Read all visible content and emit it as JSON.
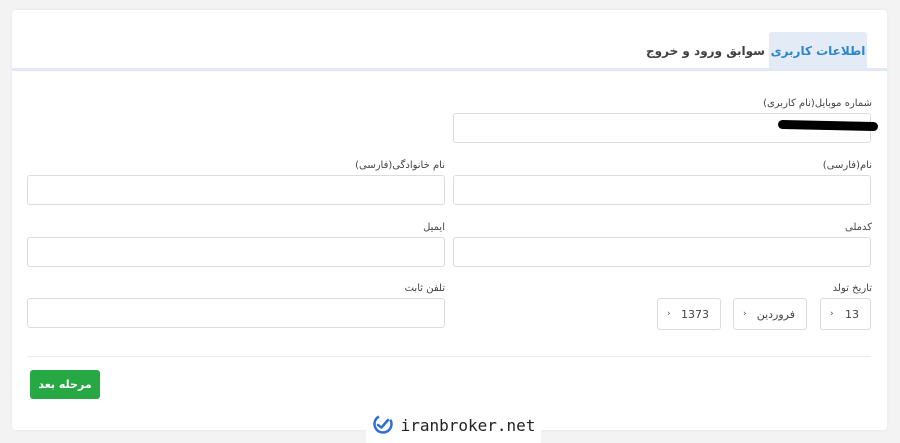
{
  "tabs": [
    {
      "label": "اطلاعات کاربری",
      "active": true
    },
    {
      "label": "سوابق ورود و خروج",
      "active": false
    }
  ],
  "form": {
    "mobile_label": "شماره موبایل(نام کاربری)",
    "mobile_value": "",
    "first_name_label": "نام(فارسی)",
    "last_name_label": "نام خانوادگی(فارسی)",
    "national_code_label": "کدملی",
    "email_label": "ایمیل",
    "birth_date_label": "تاریخ تولد",
    "birth_day": "13",
    "birth_month": "فروردین",
    "birth_year": "1373",
    "landline_label": "تلفن ثابت"
  },
  "actions": {
    "next_label": "مرحله بعد"
  },
  "watermark": {
    "text": "iranbroker.net"
  },
  "colors": {
    "accent": "#2d87c8",
    "button": "#28a745",
    "tab_bg": "#e3ebf6"
  },
  "icons": {
    "chevron": "chevron-down-icon",
    "logo": "iranbroker-logo-icon"
  }
}
